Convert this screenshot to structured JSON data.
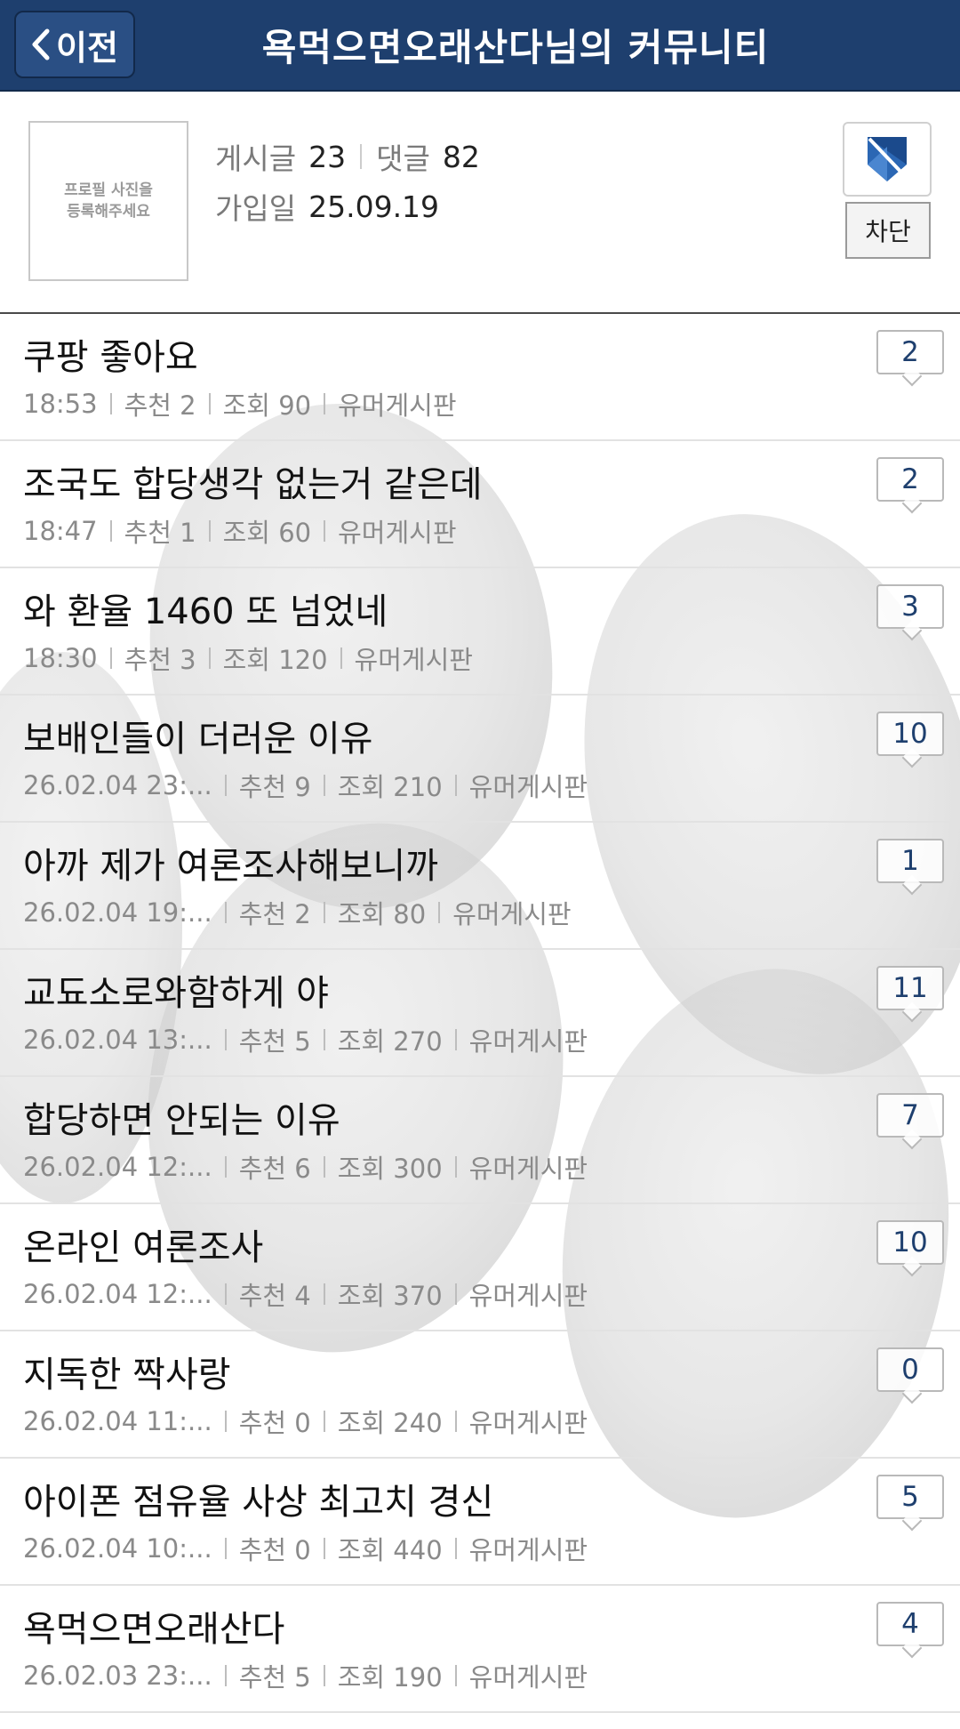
{
  "header": {
    "back_label": "이전",
    "title": "욕먹으면오래산다님의 커뮤니티"
  },
  "profile": {
    "photo_placeholder_line1": "프로필 사진을",
    "photo_placeholder_line2": "등록해주세요",
    "posts_label": "게시글",
    "posts_count": "23",
    "comments_label": "댓글",
    "comments_count": "82",
    "joined_label": "가입일",
    "joined_date": "25.09.19",
    "block_label": "차단",
    "badge_icon": "shield-badge-icon"
  },
  "posts": [
    {
      "title": "쿠팡 좋아요",
      "time": "18:53",
      "recommend": "추천 2",
      "views": "조회 90",
      "board": "유머게시판",
      "comments": "2"
    },
    {
      "title": "조국도 합당생각 없는거 같은데",
      "time": "18:47",
      "recommend": "추천 1",
      "views": "조회 60",
      "board": "유머게시판",
      "comments": "2"
    },
    {
      "title": "와 환율 1460 또 넘었네",
      "time": "18:30",
      "recommend": "추천 3",
      "views": "조회 120",
      "board": "유머게시판",
      "comments": "3"
    },
    {
      "title": "보배인들이 더러운 이유",
      "time": "26.02.04  23:...",
      "recommend": "추천 9",
      "views": "조회 210",
      "board": "유머게시판",
      "comments": "10"
    },
    {
      "title": "아까 제가 여론조사해보니까",
      "time": "26.02.04  19:...",
      "recommend": "추천 2",
      "views": "조회 80",
      "board": "유머게시판",
      "comments": "1"
    },
    {
      "title": "교됴소로와함하게 야",
      "time": "26.02.04  13:...",
      "recommend": "추천 5",
      "views": "조회 270",
      "board": "유머게시판",
      "comments": "11"
    },
    {
      "title": "합당하면 안되는 이유",
      "time": "26.02.04  12:...",
      "recommend": "추천 6",
      "views": "조회 300",
      "board": "유머게시판",
      "comments": "7"
    },
    {
      "title": "온라인 여론조사",
      "time": "26.02.04  12:...",
      "recommend": "추천 4",
      "views": "조회 370",
      "board": "유머게시판",
      "comments": "10"
    },
    {
      "title": "지독한 짝사랑",
      "time": "26.02.04  11:...",
      "recommend": "추천 0",
      "views": "조회 240",
      "board": "유머게시판",
      "comments": "0"
    },
    {
      "title": "아이폰 점유율 사상 최고치 경신",
      "time": "26.02.04  10:...",
      "recommend": "추천 0",
      "views": "조회 440",
      "board": "유머게시판",
      "comments": "5"
    },
    {
      "title": "욕먹으면오래산다",
      "time": "26.02.03  23:...",
      "recommend": "추천 5",
      "views": "조회 190",
      "board": "유머게시판",
      "comments": "4"
    }
  ],
  "colors": {
    "header_bg": "#1e3f6e",
    "comment_count_text": "#1e3f6e",
    "meta_text": "#8a8a8a"
  }
}
